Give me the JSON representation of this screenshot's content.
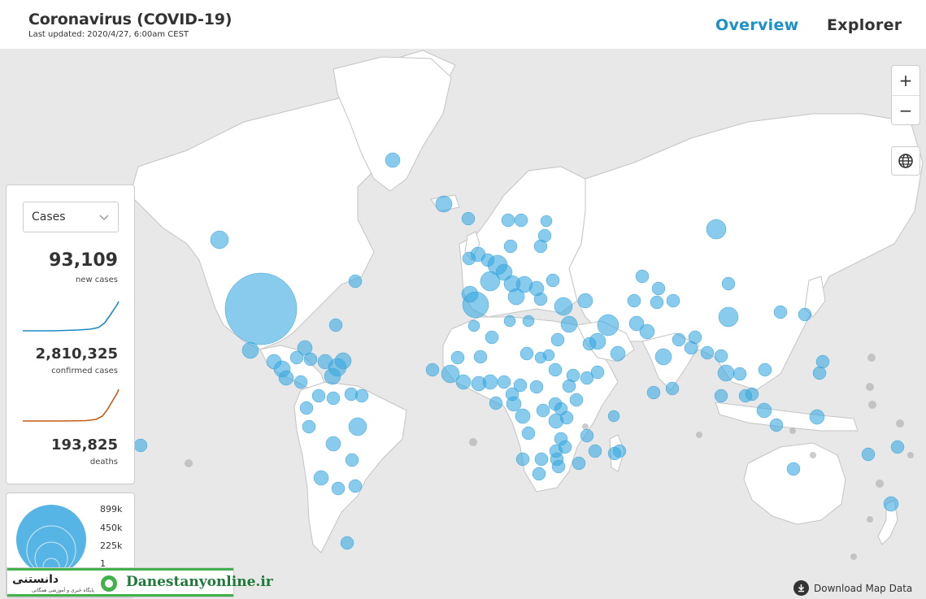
{
  "header": {
    "title": "Coronavirus (COVID-19)",
    "last_updated": "Last updated: 2020/4/27, 6:00am CEST",
    "nav": [
      {
        "label": "Overview",
        "active": true
      },
      {
        "label": "Explorer",
        "active": false
      }
    ]
  },
  "controls": {
    "zoom_in": "+",
    "zoom_out": "−",
    "globe_icon": "globe-icon"
  },
  "stats": {
    "metric_select": "Cases",
    "new_cases": {
      "value": "93,109",
      "label": "new cases"
    },
    "confirmed": {
      "value": "2,810,325",
      "label": "confirmed cases"
    },
    "deaths": {
      "value": "193,825",
      "label": "deaths"
    }
  },
  "legend": {
    "labels": [
      "899k",
      "450k",
      "225k",
      "1"
    ]
  },
  "watermark": {
    "logo": "دانستنی",
    "subtitle": "پایگاه خبری و آموزشی همگانی",
    "site": "Danestanyonline.ir"
  },
  "footer": {
    "download": "Download Map Data"
  },
  "colors": {
    "accent": "#1b91c8",
    "bubble": "#39a8e0",
    "new_cases_line": "#1b8ac4",
    "confirmed_line": "#c85a14",
    "map_background": "#e8e8e8"
  }
}
